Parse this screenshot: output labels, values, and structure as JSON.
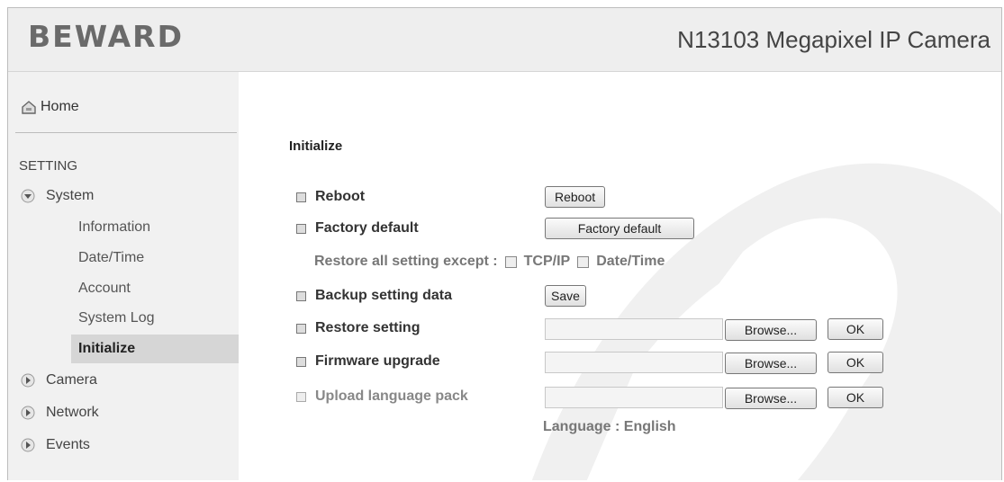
{
  "header": {
    "logo": "BEWARD",
    "camera_title": "N13103 Megapixel IP Camera"
  },
  "sidebar": {
    "home_label": "Home",
    "setting_label": "SETTING",
    "system_label": "System",
    "system_items": [
      "Information",
      "Date/Time",
      "Account",
      "System Log",
      "Initialize"
    ],
    "active_item": "Initialize",
    "camera_label": "Camera",
    "network_label": "Network",
    "events_label": "Events"
  },
  "main": {
    "section_title": "Initialize",
    "reboot_label": "Reboot",
    "reboot_button": "Reboot",
    "factory_label": "Factory default",
    "factory_button": "Factory default",
    "restore_except_label": "Restore all setting except :",
    "tcpip_label": "TCP/IP",
    "datetime_label": "Date/Time",
    "backup_label": "Backup setting data",
    "save_button": "Save",
    "restore_label": "Restore setting",
    "firmware_label": "Firmware upgrade",
    "upload_lang_label": "Upload language pack",
    "browse_button": "Browse...",
    "ok_button": "OK",
    "language_info": "Language : English"
  }
}
